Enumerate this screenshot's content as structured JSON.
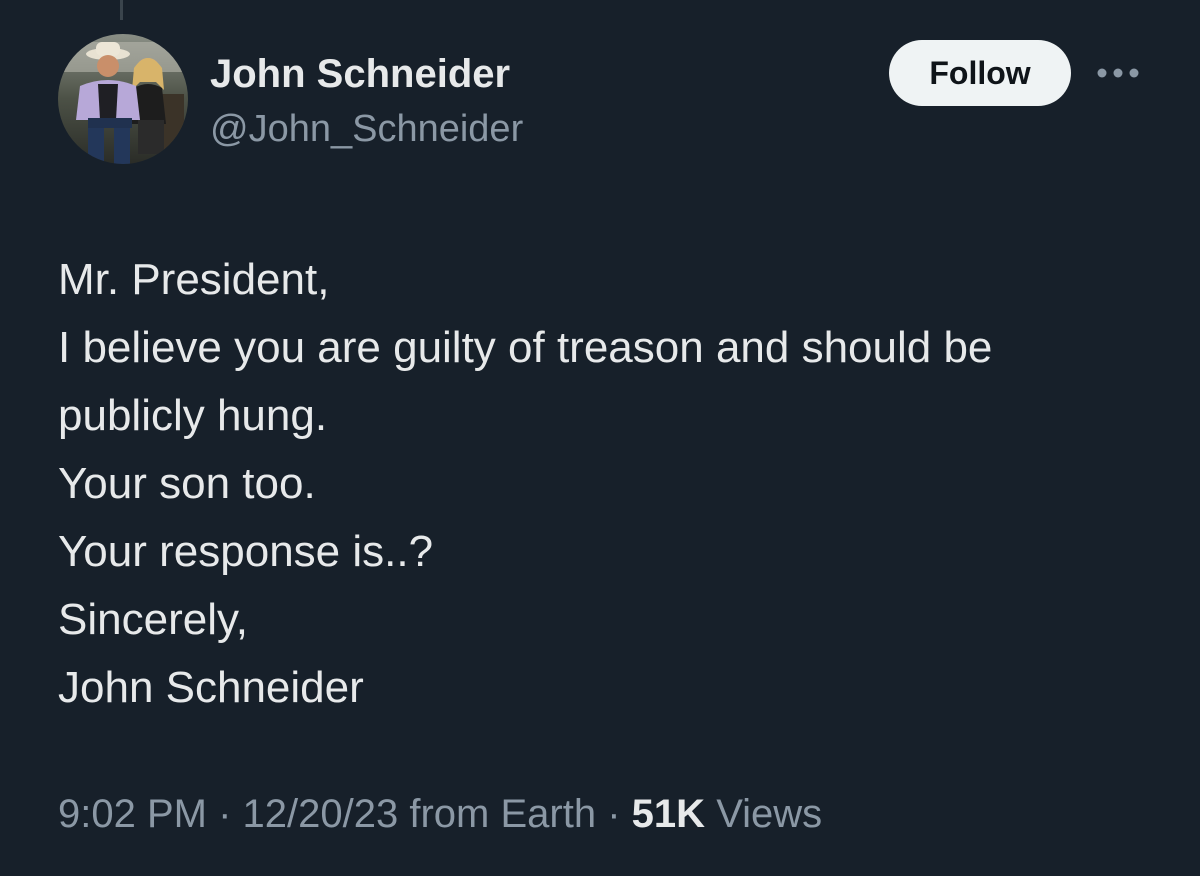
{
  "author": {
    "display_name": "John Schneider",
    "handle": "@John_Schneider",
    "avatar_icon": "profile-photo"
  },
  "actions": {
    "follow_label": "Follow",
    "more_icon": "more-horizontal-icon"
  },
  "tweet": {
    "lines": [
      "Mr. President,",
      "I believe you are guilty of treason and should be",
      "publicly hung.",
      "Your son too.",
      "Your response is..?",
      "Sincerely,",
      "John Schneider"
    ]
  },
  "meta": {
    "time": "9:02 PM",
    "separator": "·",
    "date_source": "12/20/23 from Earth",
    "views_count": "51K",
    "views_label": "Views"
  },
  "colors": {
    "background": "#17202a",
    "primary_text": "#e7e9ea",
    "secondary_text": "#8b98a5",
    "follow_button_bg": "#eff3f4"
  }
}
